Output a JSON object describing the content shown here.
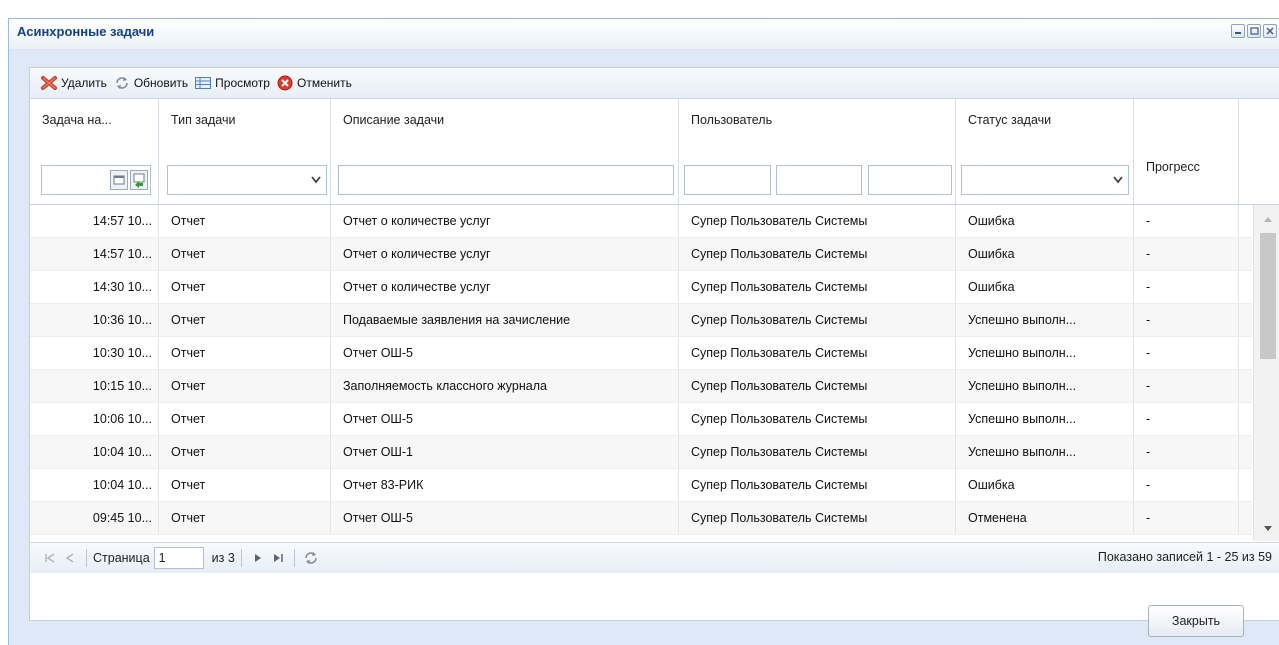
{
  "window": {
    "title": "Асинхронные задачи"
  },
  "toolbar": {
    "delete_label": "Удалить",
    "refresh_label": "Обновить",
    "view_label": "Просмотр",
    "cancel_label": "Отменить"
  },
  "grid": {
    "columns": [
      "Задача на...",
      "Тип задачи",
      "Описание задачи",
      "Пользователь",
      "Статус задачи",
      "Прогресс"
    ],
    "rows": [
      [
        "14:57 10...",
        "Отчет",
        "Отчет о количестве услуг",
        "Супер Пользователь Системы",
        "Ошибка",
        "-"
      ],
      [
        "14:57 10...",
        "Отчет",
        "Отчет о количестве услуг",
        "Супер Пользователь Системы",
        "Ошибка",
        "-"
      ],
      [
        "14:30 10...",
        "Отчет",
        "Отчет о количестве услуг",
        "Супер Пользователь Системы",
        "Ошибка",
        "-"
      ],
      [
        "10:36 10...",
        "Отчет",
        "Подаваемые заявления на зачисление",
        "Супер Пользователь Системы",
        "Успешно выполн...",
        "-"
      ],
      [
        "10:30 10...",
        "Отчет",
        "Отчет ОШ-5",
        "Супер Пользователь Системы",
        "Успешно выполн...",
        "-"
      ],
      [
        "10:15 10...",
        "Отчет",
        "Заполняемость классного журнала",
        "Супер Пользователь Системы",
        "Успешно выполн...",
        "-"
      ],
      [
        "10:06 10...",
        "Отчет",
        "Отчет ОШ-5",
        "Супер Пользователь Системы",
        "Успешно выполн...",
        "-"
      ],
      [
        "10:04 10...",
        "Отчет",
        "Отчет ОШ-1",
        "Супер Пользователь Системы",
        "Успешно выполн...",
        "-"
      ],
      [
        "10:04 10...",
        "Отчет",
        "Отчет 83-РИК",
        "Супер Пользователь Системы",
        "Ошибка",
        "-"
      ],
      [
        "09:45 10...",
        "Отчет",
        "Отчет ОШ-5",
        "Супер Пользователь Системы",
        "Отменена",
        "-"
      ]
    ]
  },
  "pager": {
    "page_label": "Страница",
    "page_value": "1",
    "of_label": "из 3",
    "info": "Показано записей 1 - 25 из 59"
  },
  "footer": {
    "close_label": "Закрыть"
  },
  "colors": {
    "title": "#15428b",
    "panel_bg": "#dfe8f6",
    "border": "#99bbe8"
  }
}
